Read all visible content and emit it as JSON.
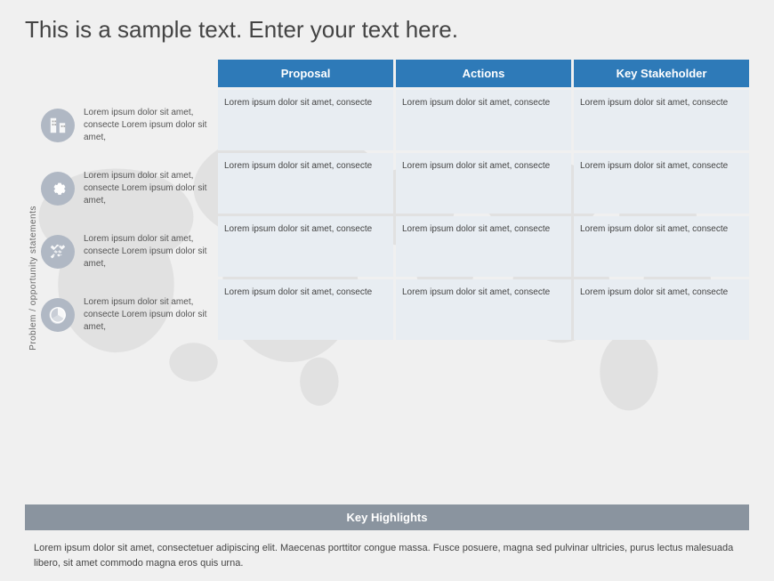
{
  "title": "This is a sample text. Enter your text here.",
  "table": {
    "headers": [
      "Proposal",
      "Actions",
      "Key Stakeholder"
    ],
    "cell_text": "Lorem ipsum dolor sit amet, consecte",
    "rows": [
      {
        "icon": "building",
        "problem": "Lorem ipsum dolor sit amet, consecte Lorem ipsum dolor sit amet,",
        "proposal": "Lorem ipsum dolor sit amet, consecte",
        "actions": "Lorem ipsum dolor sit amet, consecte",
        "stakeholder": "Lorem ipsum dolor sit amet, consecte"
      },
      {
        "icon": "gear",
        "problem": "Lorem ipsum dolor sit amet, consecte Lorem ipsum dolor sit amet,",
        "proposal": "Lorem ipsum dolor sit amet, consecte",
        "actions": "Lorem ipsum dolor sit amet, consecte",
        "stakeholder": "Lorem ipsum dolor sit amet, consecte"
      },
      {
        "icon": "handshake",
        "problem": "Lorem ipsum dolor sit amet, consecte Lorem ipsum dolor sit amet,",
        "proposal": "Lorem ipsum dolor sit amet, consecte",
        "actions": "Lorem ipsum dolor sit amet, consecte",
        "stakeholder": "Lorem ipsum dolor sit amet, consecte"
      },
      {
        "icon": "chart",
        "problem": "Lorem ipsum dolor sit amet, consecte Lorem ipsum dolor sit amet,",
        "proposal": "Lorem ipsum dolor sit amet, consecte",
        "actions": "Lorem ipsum dolor sit amet, consecte",
        "stakeholder": "Lorem ipsum dolor sit amet, consecte"
      }
    ]
  },
  "vertical_label": "Problem / opportunity statements",
  "bottom": {
    "bar_label": "Key Highlights",
    "highlights_text": "Lorem ipsum dolor sit amet, consectetuer adipiscing elit. Maecenas porttitor congue massa. Fusce posuere, magna sed pulvinar ultricies, purus lectus malesuada libero, sit amet commodo magna eros quis urna."
  }
}
